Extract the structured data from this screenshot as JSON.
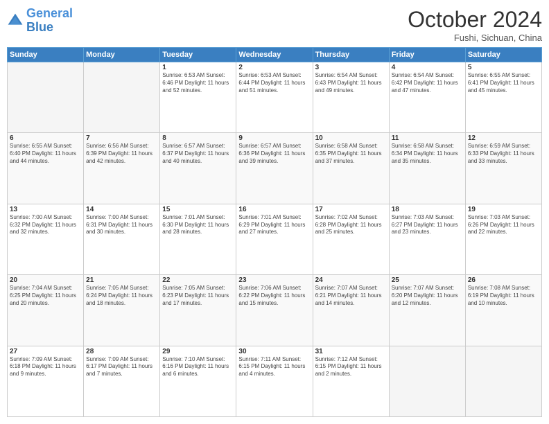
{
  "header": {
    "logo_general": "General",
    "logo_blue": "Blue",
    "month_title": "October 2024",
    "subtitle": "Fushi, Sichuan, China"
  },
  "weekdays": [
    "Sunday",
    "Monday",
    "Tuesday",
    "Wednesday",
    "Thursday",
    "Friday",
    "Saturday"
  ],
  "weeks": [
    [
      {
        "day": "",
        "detail": ""
      },
      {
        "day": "",
        "detail": ""
      },
      {
        "day": "1",
        "detail": "Sunrise: 6:53 AM\nSunset: 6:46 PM\nDaylight: 11 hours and 52 minutes."
      },
      {
        "day": "2",
        "detail": "Sunrise: 6:53 AM\nSunset: 6:44 PM\nDaylight: 11 hours and 51 minutes."
      },
      {
        "day": "3",
        "detail": "Sunrise: 6:54 AM\nSunset: 6:43 PM\nDaylight: 11 hours and 49 minutes."
      },
      {
        "day": "4",
        "detail": "Sunrise: 6:54 AM\nSunset: 6:42 PM\nDaylight: 11 hours and 47 minutes."
      },
      {
        "day": "5",
        "detail": "Sunrise: 6:55 AM\nSunset: 6:41 PM\nDaylight: 11 hours and 45 minutes."
      }
    ],
    [
      {
        "day": "6",
        "detail": "Sunrise: 6:55 AM\nSunset: 6:40 PM\nDaylight: 11 hours and 44 minutes."
      },
      {
        "day": "7",
        "detail": "Sunrise: 6:56 AM\nSunset: 6:39 PM\nDaylight: 11 hours and 42 minutes."
      },
      {
        "day": "8",
        "detail": "Sunrise: 6:57 AM\nSunset: 6:37 PM\nDaylight: 11 hours and 40 minutes."
      },
      {
        "day": "9",
        "detail": "Sunrise: 6:57 AM\nSunset: 6:36 PM\nDaylight: 11 hours and 39 minutes."
      },
      {
        "day": "10",
        "detail": "Sunrise: 6:58 AM\nSunset: 6:35 PM\nDaylight: 11 hours and 37 minutes."
      },
      {
        "day": "11",
        "detail": "Sunrise: 6:58 AM\nSunset: 6:34 PM\nDaylight: 11 hours and 35 minutes."
      },
      {
        "day": "12",
        "detail": "Sunrise: 6:59 AM\nSunset: 6:33 PM\nDaylight: 11 hours and 33 minutes."
      }
    ],
    [
      {
        "day": "13",
        "detail": "Sunrise: 7:00 AM\nSunset: 6:32 PM\nDaylight: 11 hours and 32 minutes."
      },
      {
        "day": "14",
        "detail": "Sunrise: 7:00 AM\nSunset: 6:31 PM\nDaylight: 11 hours and 30 minutes."
      },
      {
        "day": "15",
        "detail": "Sunrise: 7:01 AM\nSunset: 6:30 PM\nDaylight: 11 hours and 28 minutes."
      },
      {
        "day": "16",
        "detail": "Sunrise: 7:01 AM\nSunset: 6:29 PM\nDaylight: 11 hours and 27 minutes."
      },
      {
        "day": "17",
        "detail": "Sunrise: 7:02 AM\nSunset: 6:28 PM\nDaylight: 11 hours and 25 minutes."
      },
      {
        "day": "18",
        "detail": "Sunrise: 7:03 AM\nSunset: 6:27 PM\nDaylight: 11 hours and 23 minutes."
      },
      {
        "day": "19",
        "detail": "Sunrise: 7:03 AM\nSunset: 6:26 PM\nDaylight: 11 hours and 22 minutes."
      }
    ],
    [
      {
        "day": "20",
        "detail": "Sunrise: 7:04 AM\nSunset: 6:25 PM\nDaylight: 11 hours and 20 minutes."
      },
      {
        "day": "21",
        "detail": "Sunrise: 7:05 AM\nSunset: 6:24 PM\nDaylight: 11 hours and 18 minutes."
      },
      {
        "day": "22",
        "detail": "Sunrise: 7:05 AM\nSunset: 6:23 PM\nDaylight: 11 hours and 17 minutes."
      },
      {
        "day": "23",
        "detail": "Sunrise: 7:06 AM\nSunset: 6:22 PM\nDaylight: 11 hours and 15 minutes."
      },
      {
        "day": "24",
        "detail": "Sunrise: 7:07 AM\nSunset: 6:21 PM\nDaylight: 11 hours and 14 minutes."
      },
      {
        "day": "25",
        "detail": "Sunrise: 7:07 AM\nSunset: 6:20 PM\nDaylight: 11 hours and 12 minutes."
      },
      {
        "day": "26",
        "detail": "Sunrise: 7:08 AM\nSunset: 6:19 PM\nDaylight: 11 hours and 10 minutes."
      }
    ],
    [
      {
        "day": "27",
        "detail": "Sunrise: 7:09 AM\nSunset: 6:18 PM\nDaylight: 11 hours and 9 minutes."
      },
      {
        "day": "28",
        "detail": "Sunrise: 7:09 AM\nSunset: 6:17 PM\nDaylight: 11 hours and 7 minutes."
      },
      {
        "day": "29",
        "detail": "Sunrise: 7:10 AM\nSunset: 6:16 PM\nDaylight: 11 hours and 6 minutes."
      },
      {
        "day": "30",
        "detail": "Sunrise: 7:11 AM\nSunset: 6:15 PM\nDaylight: 11 hours and 4 minutes."
      },
      {
        "day": "31",
        "detail": "Sunrise: 7:12 AM\nSunset: 6:15 PM\nDaylight: 11 hours and 2 minutes."
      },
      {
        "day": "",
        "detail": ""
      },
      {
        "day": "",
        "detail": ""
      }
    ]
  ]
}
